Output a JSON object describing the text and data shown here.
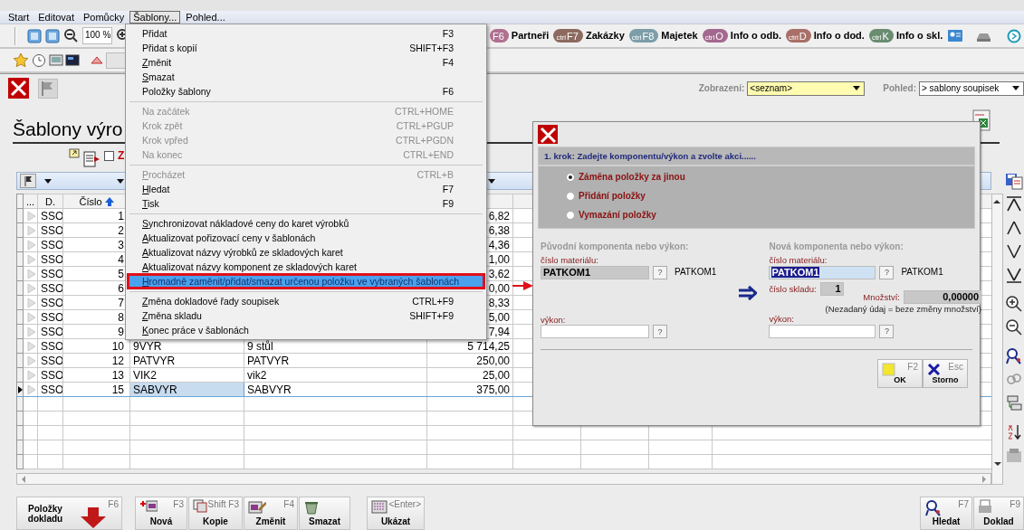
{
  "menu_bar": [
    {
      "label": "Start",
      "selected": false
    },
    {
      "label": "Editovat",
      "selected": false
    },
    {
      "label": "Pomůcky",
      "selected": false
    },
    {
      "label": "Šablony...",
      "selected": true
    },
    {
      "label": "Pohled...",
      "selected": false
    }
  ],
  "toolbar": {
    "zoom": "100 %",
    "shortcuts": [
      {
        "key": "F6",
        "label": "Partneři",
        "color": "#b07090"
      },
      {
        "prefix": "ctrl",
        "key": "F7",
        "label": "Zakázky",
        "color": "#8c6a60"
      },
      {
        "prefix": "ctrl",
        "key": "F8",
        "label": "Majetek",
        "color": "#7c9ea8"
      },
      {
        "prefix": "ctrl",
        "key": "O",
        "label": "Info o odb.",
        "color": "#a46890"
      },
      {
        "prefix": "ctrl",
        "key": "D",
        "label": "Info o dod.",
        "color": "#a87068"
      },
      {
        "prefix": "ctrl",
        "key": "K",
        "label": "Info o skl.",
        "color": "#6a8c70"
      }
    ]
  },
  "view": {
    "display_label": "Zobrazení:",
    "display_value": "<seznam>",
    "view_label": "Pohled:",
    "view_value": "> sablony soupisek"
  },
  "title": "Šablony výro",
  "filter_checkbox": {
    "label": "Z",
    "checked": false
  },
  "table": {
    "columns": [
      "...",
      "D.",
      "Číslo"
    ],
    "rows": [
      {
        "d": "SSO",
        "number": "1",
        "amount": "6,82",
        "selected": false
      },
      {
        "d": "SSO",
        "number": "2",
        "amount": "6,38",
        "selected": false
      },
      {
        "d": "SSO",
        "number": "3",
        "amount": "4,36",
        "selected": false
      },
      {
        "d": "SSO",
        "number": "4",
        "amount": "1,00",
        "selected": false
      },
      {
        "d": "SSO",
        "number": "5",
        "amount": "3,62",
        "selected": false
      },
      {
        "d": "SSO",
        "number": "6",
        "amount": "0,00",
        "selected": false
      },
      {
        "d": "SSO",
        "number": "7",
        "amount": "8,33",
        "selected": false
      },
      {
        "d": "SSO",
        "number": "8",
        "amount": "5,00",
        "selected": false
      },
      {
        "d": "SSO",
        "number": "9",
        "amount": "7,94",
        "selected": false
      },
      {
        "d": "SSO",
        "number": "10",
        "code": "9VYR",
        "name": "9 stůl",
        "amount": "5 714,25",
        "selected": false
      },
      {
        "d": "SSO",
        "number": "12",
        "code": "PATVYR",
        "name": "PATVYR",
        "amount": "250,00",
        "selected": false
      },
      {
        "d": "SSO",
        "number": "13",
        "code": "VIK2",
        "name": "vik2",
        "amount": "25,00",
        "selected": false
      },
      {
        "d": "SSO",
        "number": "15",
        "code": "SABVYR",
        "name": "SABVYR",
        "amount": "375,00",
        "selected": true
      }
    ]
  },
  "sablony_menu": [
    {
      "kind": "item",
      "label": "Přidat",
      "shortcut": "F3",
      "disabled": false,
      "underline": false,
      "selected": false
    },
    {
      "kind": "item",
      "label": "Přidat s kopií",
      "shortcut": "SHIFT+F3",
      "disabled": false,
      "underline": false,
      "selected": false
    },
    {
      "kind": "item",
      "label": "Změnit",
      "shortcut": "F4",
      "disabled": false,
      "underline": true,
      "selected": false
    },
    {
      "kind": "item",
      "label": "Smazat",
      "disabled": false,
      "underline": true,
      "selected": false
    },
    {
      "kind": "item",
      "label": "Položky šablony",
      "shortcut": "F6",
      "disabled": false,
      "underline": false,
      "selected": false
    },
    {
      "kind": "separator"
    },
    {
      "kind": "item",
      "label": "Na začátek",
      "shortcut": "CTRL+HOME",
      "disabled": true,
      "underline": false,
      "selected": false
    },
    {
      "kind": "item",
      "label": "Krok zpět",
      "shortcut": "CTRL+PGUP",
      "disabled": true,
      "underline": false,
      "selected": false
    },
    {
      "kind": "item",
      "label": "Krok vpřed",
      "shortcut": "CTRL+PGDN",
      "disabled": true,
      "underline": false,
      "selected": false
    },
    {
      "kind": "item",
      "label": "Na konec",
      "shortcut": "CTRL+END",
      "disabled": true,
      "underline": false,
      "selected": false
    },
    {
      "kind": "separator"
    },
    {
      "kind": "item",
      "label": "Procházet",
      "shortcut": "CTRL+B",
      "disabled": true,
      "underline": true,
      "selected": false
    },
    {
      "kind": "item",
      "label": "Hledat",
      "shortcut": "F7",
      "disabled": false,
      "underline": true,
      "selected": false
    },
    {
      "kind": "item",
      "label": "Tisk",
      "shortcut": "F9",
      "disabled": false,
      "underline": true,
      "selected": false
    },
    {
      "kind": "separator"
    },
    {
      "kind": "item",
      "label": "Synchronizovat nákladové ceny do karet výrobků",
      "disabled": false,
      "underline": true,
      "selected": false
    },
    {
      "kind": "item",
      "label": "Aktualizovat pořizovací ceny v šablonách",
      "disabled": false,
      "underline": true,
      "selected": false
    },
    {
      "kind": "item",
      "label": "Aktualizovat názvy výrobků ze skladových karet",
      "disabled": false,
      "underline": true,
      "selected": false
    },
    {
      "kind": "item",
      "label": "Aktualizovat názvy komponent ze skladových karet",
      "disabled": false,
      "underline": true,
      "selected": false
    },
    {
      "kind": "item",
      "label": "Hromadně zaměnit/přidat/smazat určenou položku ve vybraných šablonách",
      "disabled": false,
      "underline": true,
      "selected": true,
      "callout": true
    },
    {
      "kind": "separator"
    },
    {
      "kind": "item",
      "label": "Změna dokladové řady soupisek",
      "shortcut": "CTRL+F9",
      "disabled": false,
      "underline": true,
      "selected": false
    },
    {
      "kind": "item",
      "label": "Změna skladu",
      "shortcut": "SHIFT+F9",
      "disabled": false,
      "underline": true,
      "selected": false
    },
    {
      "kind": "item",
      "label": "Konec práce v šablonách",
      "disabled": false,
      "underline": true,
      "selected": false
    }
  ],
  "dialog": {
    "step": "1. krok: Zadejte komponentu/výkon a zvolte akci......",
    "options": [
      {
        "label": "Záměna položky za jinou",
        "selected": true
      },
      {
        "label": "Přidání položky",
        "selected": false
      },
      {
        "label": "Vymazání položky",
        "selected": false
      }
    ],
    "original": {
      "heading": "Původní komponenta nebo výkon:",
      "material_label": "číslo materiálu:",
      "material_value": "PATKOM1",
      "help": "?",
      "material_name": "PATKOM1",
      "output_label": "výkon:",
      "output_help": "?"
    },
    "new": {
      "heading": "Nová komponenta nebo výkon:",
      "material_label": "číslo materiálu:",
      "material_value": "PATKOM1",
      "text_selected": true,
      "help": "?",
      "material_name": "PATKOM1",
      "store_label": "číslo skladu:",
      "store_value": "1",
      "quantity_label": "Množství:",
      "quantity_value": "0,00000",
      "note": "(Nezadaný údaj = beze změny množství)",
      "output_label": "výkon:",
      "output_help": "?"
    },
    "buttons": [
      {
        "kind": "ok",
        "key": "F2",
        "label": "OK"
      },
      {
        "kind": "cancel",
        "key": "Esc",
        "label": "Storno"
      }
    ]
  },
  "bottom_buttons": [
    {
      "kind": "items",
      "label": "Položky dokladu",
      "key": "F6"
    },
    {
      "kind": "new",
      "label": "Nová",
      "key": "F3"
    },
    {
      "kind": "copy",
      "label": "Kopie",
      "key": "Shift F3"
    },
    {
      "kind": "edit",
      "label": "Změnit",
      "key": "F4"
    },
    {
      "kind": "delete",
      "label": "Smazat"
    },
    {
      "kind": "show",
      "label": "Ukázat",
      "key": "<Enter>"
    }
  ],
  "bottom_right_buttons": [
    {
      "kind": "find",
      "label": "Hledat",
      "key": "F7"
    },
    {
      "kind": "print",
      "label": "Doklad",
      "key": "F9"
    }
  ]
}
